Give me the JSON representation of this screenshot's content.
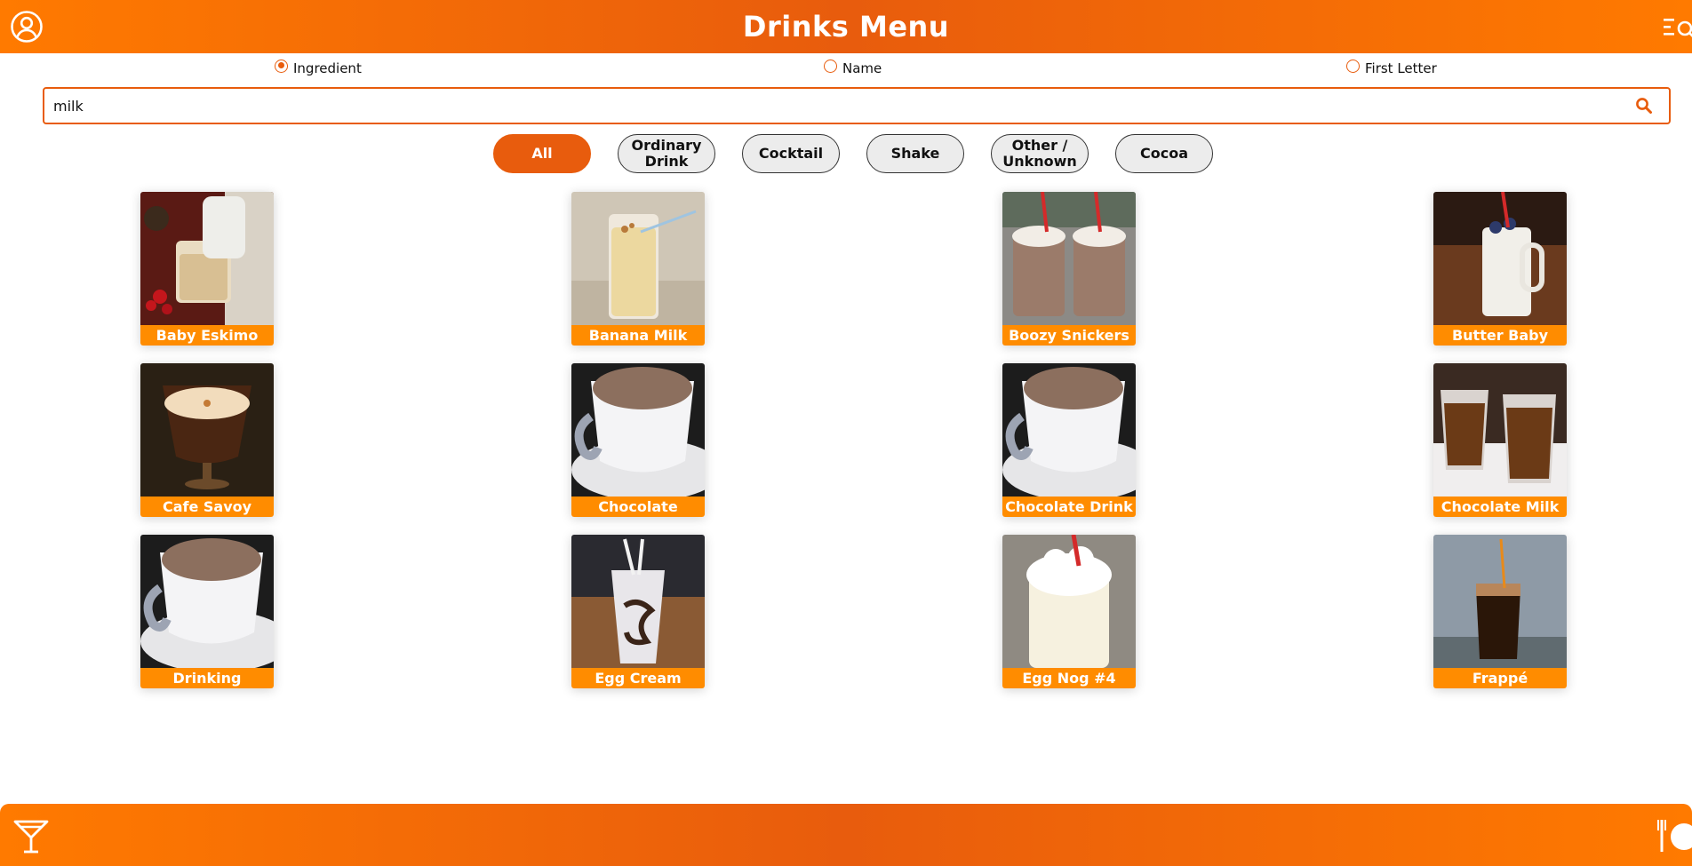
{
  "header": {
    "title": "Drinks Menu",
    "profile_icon": "user-circle-icon",
    "menu_icon": "menu-search-icon"
  },
  "search": {
    "options": [
      {
        "label": "Ingredient",
        "checked": true
      },
      {
        "label": "Name",
        "checked": false
      },
      {
        "label": "First Letter",
        "checked": false
      }
    ],
    "value": "milk",
    "icon": "search-icon"
  },
  "categories": [
    {
      "label": "All",
      "active": true
    },
    {
      "label": "Ordinary Drink",
      "active": false
    },
    {
      "label": "Cocktail",
      "active": false
    },
    {
      "label": "Shake",
      "active": false
    },
    {
      "label": "Other / Unknown",
      "active": false
    },
    {
      "label": "Cocoa",
      "active": false
    }
  ],
  "drinks": [
    {
      "name": "Baby Eskimo"
    },
    {
      "name": "Banana Milk"
    },
    {
      "name": "Boozy Snickers"
    },
    {
      "name": "Butter Baby"
    },
    {
      "name": "Cafe Savoy"
    },
    {
      "name": "Chocolate"
    },
    {
      "name": "Chocolate Drink"
    },
    {
      "name": "Chocolate Milk"
    },
    {
      "name": "Drinking"
    },
    {
      "name": "Egg Cream"
    },
    {
      "name": "Egg Nog #4"
    },
    {
      "name": "Frappé"
    }
  ],
  "footer": {
    "left_icon": "cocktail-icon",
    "right_icon": "restaurant-icon"
  },
  "colors": {
    "accent": "#e85c0d",
    "header_gradient_light": "#ff7a00",
    "label_bar": "#ff8c00"
  }
}
